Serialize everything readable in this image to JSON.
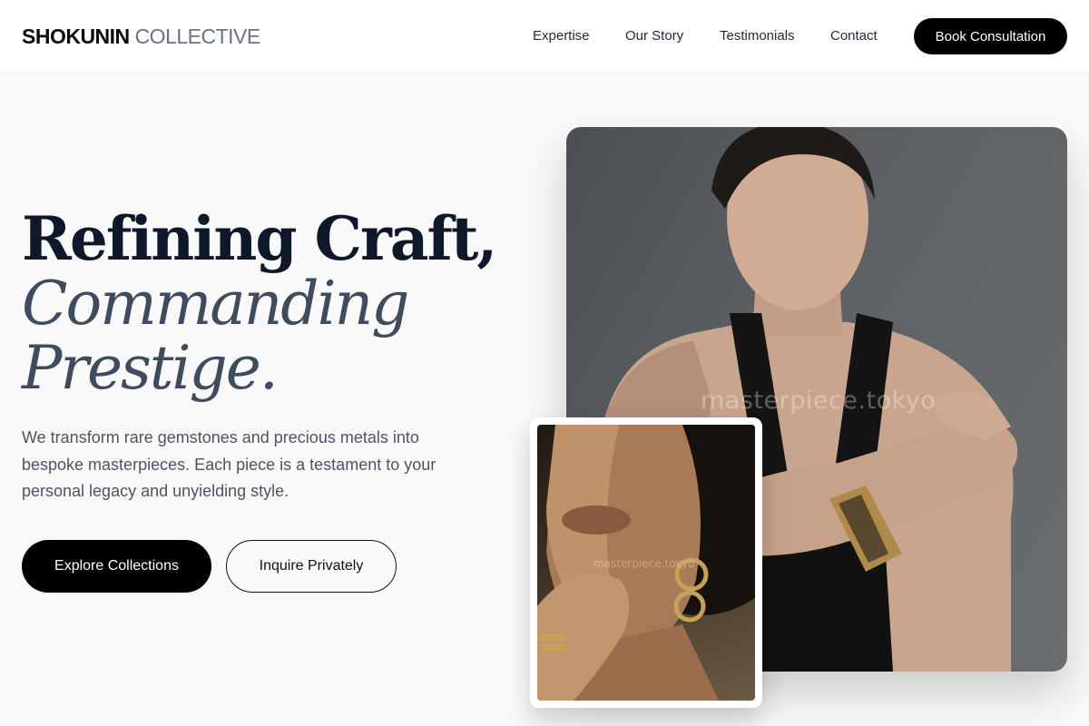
{
  "brand": {
    "name_strong": "SHOKUNIN",
    "name_light": "COLLECTIVE"
  },
  "nav": {
    "items": [
      {
        "label": "Expertise"
      },
      {
        "label": "Our Story"
      },
      {
        "label": "Testimonials"
      },
      {
        "label": "Contact"
      }
    ],
    "cta_label": "Book Consultation"
  },
  "hero": {
    "headline_line1": "Refining Craft,",
    "headline_line2": "Commanding",
    "headline_line3": "Prestige.",
    "tagline": "We transform rare gemstones and precious metals into bespoke masterpieces. Each piece is a testament to your personal legacy and unyielding style.",
    "primary_button": "Explore Collections",
    "secondary_button": "Inquire Privately"
  },
  "images": {
    "main_watermark": "masterpiece.tokyo",
    "inset_watermark": "masterpiece.tokyo"
  },
  "colors": {
    "page_background": "#f9f9f9",
    "primary_button": "#000000",
    "headline_dark": "#0f172a",
    "headline_italic": "#3f4b5f",
    "body_text": "#4b5563"
  }
}
